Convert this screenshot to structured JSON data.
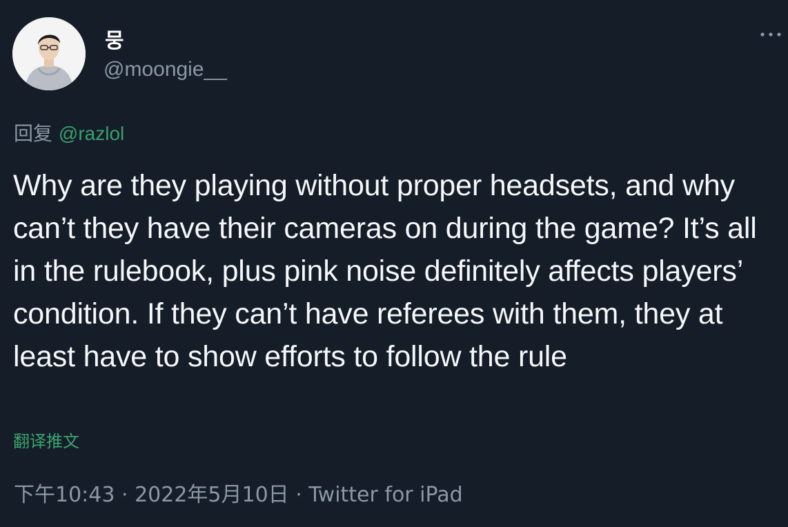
{
  "author": {
    "display_name": "뭉",
    "handle": "@moongie__"
  },
  "reply": {
    "prefix": "回复",
    "handle": "@razlol"
  },
  "tweet": {
    "text": "Why are they playing without proper headsets, and why can’t they have their cameras on during the game? It’s all in the rulebook, plus pink noise definitely affects players’ condition. If they can’t have referees with them, they at least have to show efforts to follow the rule"
  },
  "translate_label": "翻译推文",
  "meta": {
    "time": "下午10:43",
    "separator": " · ",
    "date": "2022年5月10日",
    "source": "Twitter for iPad"
  },
  "icons": {
    "more": "more-dots-icon"
  },
  "colors": {
    "background": "#151d29",
    "text": "#f5f7f9",
    "secondary": "#8b98a5",
    "link_green": "#39a16a"
  }
}
